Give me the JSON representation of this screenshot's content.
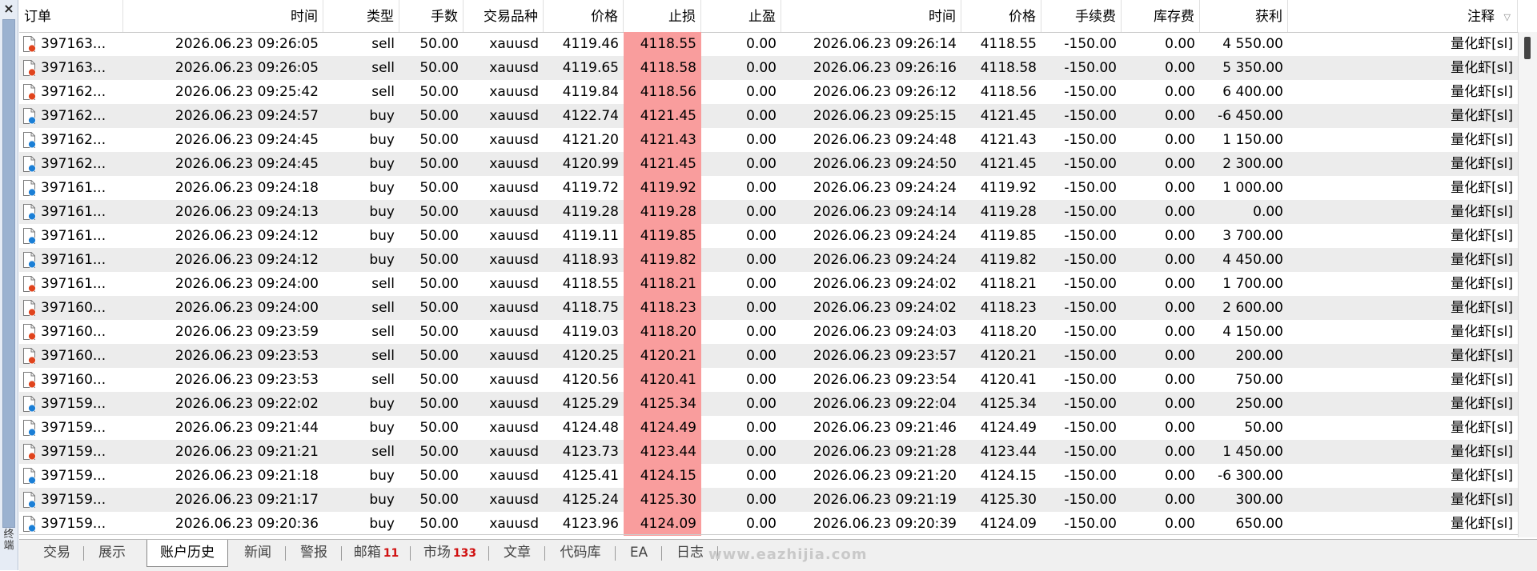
{
  "side_panel": {
    "close_glyph": "×",
    "label": "终端"
  },
  "columns": [
    "订单",
    "时间",
    "类型",
    "手数",
    "交易品种",
    "价格",
    "止损",
    "止盈",
    "时间",
    "价格",
    "手续费",
    "库存费",
    "获利",
    "注释"
  ],
  "colors": {
    "stop_loss_highlight": "#f99d9d",
    "row_alt": "#ececec",
    "sell_icon": "#e0441d",
    "buy_icon": "#1b7fd6",
    "badge": "#d01010"
  },
  "rows": [
    {
      "order": "397163...",
      "open_time": "2026.06.23 09:26:05",
      "type": "sell",
      "lots": "50.00",
      "symbol": "xauusd",
      "price": "4119.46",
      "sl": "4118.55",
      "tp": "0.00",
      "close_time": "2026.06.23 09:26:14",
      "close_price": "4118.55",
      "commission": "-150.00",
      "swap": "0.00",
      "profit": "4 550.00",
      "comment": "量化虾[sl]"
    },
    {
      "order": "397163...",
      "open_time": "2026.06.23 09:26:05",
      "type": "sell",
      "lots": "50.00",
      "symbol": "xauusd",
      "price": "4119.65",
      "sl": "4118.58",
      "tp": "0.00",
      "close_time": "2026.06.23 09:26:16",
      "close_price": "4118.58",
      "commission": "-150.00",
      "swap": "0.00",
      "profit": "5 350.00",
      "comment": "量化虾[sl]"
    },
    {
      "order": "397162...",
      "open_time": "2026.06.23 09:25:42",
      "type": "sell",
      "lots": "50.00",
      "symbol": "xauusd",
      "price": "4119.84",
      "sl": "4118.56",
      "tp": "0.00",
      "close_time": "2026.06.23 09:26:12",
      "close_price": "4118.56",
      "commission": "-150.00",
      "swap": "0.00",
      "profit": "6 400.00",
      "comment": "量化虾[sl]"
    },
    {
      "order": "397162...",
      "open_time": "2026.06.23 09:24:57",
      "type": "buy",
      "lots": "50.00",
      "symbol": "xauusd",
      "price": "4122.74",
      "sl": "4121.45",
      "tp": "0.00",
      "close_time": "2026.06.23 09:25:15",
      "close_price": "4121.45",
      "commission": "-150.00",
      "swap": "0.00",
      "profit": "-6 450.00",
      "comment": "量化虾[sl]"
    },
    {
      "order": "397162...",
      "open_time": "2026.06.23 09:24:45",
      "type": "buy",
      "lots": "50.00",
      "symbol": "xauusd",
      "price": "4121.20",
      "sl": "4121.43",
      "tp": "0.00",
      "close_time": "2026.06.23 09:24:48",
      "close_price": "4121.43",
      "commission": "-150.00",
      "swap": "0.00",
      "profit": "1 150.00",
      "comment": "量化虾[sl]"
    },
    {
      "order": "397162...",
      "open_time": "2026.06.23 09:24:45",
      "type": "buy",
      "lots": "50.00",
      "symbol": "xauusd",
      "price": "4120.99",
      "sl": "4121.45",
      "tp": "0.00",
      "close_time": "2026.06.23 09:24:50",
      "close_price": "4121.45",
      "commission": "-150.00",
      "swap": "0.00",
      "profit": "2 300.00",
      "comment": "量化虾[sl]"
    },
    {
      "order": "397161...",
      "open_time": "2026.06.23 09:24:18",
      "type": "buy",
      "lots": "50.00",
      "symbol": "xauusd",
      "price": "4119.72",
      "sl": "4119.92",
      "tp": "0.00",
      "close_time": "2026.06.23 09:24:24",
      "close_price": "4119.92",
      "commission": "-150.00",
      "swap": "0.00",
      "profit": "1 000.00",
      "comment": "量化虾[sl]"
    },
    {
      "order": "397161...",
      "open_time": "2026.06.23 09:24:13",
      "type": "buy",
      "lots": "50.00",
      "symbol": "xauusd",
      "price": "4119.28",
      "sl": "4119.28",
      "tp": "0.00",
      "close_time": "2026.06.23 09:24:14",
      "close_price": "4119.28",
      "commission": "-150.00",
      "swap": "0.00",
      "profit": "0.00",
      "comment": "量化虾[sl]"
    },
    {
      "order": "397161...",
      "open_time": "2026.06.23 09:24:12",
      "type": "buy",
      "lots": "50.00",
      "symbol": "xauusd",
      "price": "4119.11",
      "sl": "4119.85",
      "tp": "0.00",
      "close_time": "2026.06.23 09:24:24",
      "close_price": "4119.85",
      "commission": "-150.00",
      "swap": "0.00",
      "profit": "3 700.00",
      "comment": "量化虾[sl]"
    },
    {
      "order": "397161...",
      "open_time": "2026.06.23 09:24:12",
      "type": "buy",
      "lots": "50.00",
      "symbol": "xauusd",
      "price": "4118.93",
      "sl": "4119.82",
      "tp": "0.00",
      "close_time": "2026.06.23 09:24:24",
      "close_price": "4119.82",
      "commission": "-150.00",
      "swap": "0.00",
      "profit": "4 450.00",
      "comment": "量化虾[sl]"
    },
    {
      "order": "397161...",
      "open_time": "2026.06.23 09:24:00",
      "type": "sell",
      "lots": "50.00",
      "symbol": "xauusd",
      "price": "4118.55",
      "sl": "4118.21",
      "tp": "0.00",
      "close_time": "2026.06.23 09:24:02",
      "close_price": "4118.21",
      "commission": "-150.00",
      "swap": "0.00",
      "profit": "1 700.00",
      "comment": "量化虾[sl]"
    },
    {
      "order": "397160...",
      "open_time": "2026.06.23 09:24:00",
      "type": "sell",
      "lots": "50.00",
      "symbol": "xauusd",
      "price": "4118.75",
      "sl": "4118.23",
      "tp": "0.00",
      "close_time": "2026.06.23 09:24:02",
      "close_price": "4118.23",
      "commission": "-150.00",
      "swap": "0.00",
      "profit": "2 600.00",
      "comment": "量化虾[sl]"
    },
    {
      "order": "397160...",
      "open_time": "2026.06.23 09:23:59",
      "type": "sell",
      "lots": "50.00",
      "symbol": "xauusd",
      "price": "4119.03",
      "sl": "4118.20",
      "tp": "0.00",
      "close_time": "2026.06.23 09:24:03",
      "close_price": "4118.20",
      "commission": "-150.00",
      "swap": "0.00",
      "profit": "4 150.00",
      "comment": "量化虾[sl]"
    },
    {
      "order": "397160...",
      "open_time": "2026.06.23 09:23:53",
      "type": "sell",
      "lots": "50.00",
      "symbol": "xauusd",
      "price": "4120.25",
      "sl": "4120.21",
      "tp": "0.00",
      "close_time": "2026.06.23 09:23:57",
      "close_price": "4120.21",
      "commission": "-150.00",
      "swap": "0.00",
      "profit": "200.00",
      "comment": "量化虾[sl]"
    },
    {
      "order": "397160...",
      "open_time": "2026.06.23 09:23:53",
      "type": "sell",
      "lots": "50.00",
      "symbol": "xauusd",
      "price": "4120.56",
      "sl": "4120.41",
      "tp": "0.00",
      "close_time": "2026.06.23 09:23:54",
      "close_price": "4120.41",
      "commission": "-150.00",
      "swap": "0.00",
      "profit": "750.00",
      "comment": "量化虾[sl]"
    },
    {
      "order": "397159...",
      "open_time": "2026.06.23 09:22:02",
      "type": "buy",
      "lots": "50.00",
      "symbol": "xauusd",
      "price": "4125.29",
      "sl": "4125.34",
      "tp": "0.00",
      "close_time": "2026.06.23 09:22:04",
      "close_price": "4125.34",
      "commission": "-150.00",
      "swap": "0.00",
      "profit": "250.00",
      "comment": "量化虾[sl]"
    },
    {
      "order": "397159...",
      "open_time": "2026.06.23 09:21:44",
      "type": "buy",
      "lots": "50.00",
      "symbol": "xauusd",
      "price": "4124.48",
      "sl": "4124.49",
      "tp": "0.00",
      "close_time": "2026.06.23 09:21:46",
      "close_price": "4124.49",
      "commission": "-150.00",
      "swap": "0.00",
      "profit": "50.00",
      "comment": "量化虾[sl]"
    },
    {
      "order": "397159...",
      "open_time": "2026.06.23 09:21:21",
      "type": "sell",
      "lots": "50.00",
      "symbol": "xauusd",
      "price": "4123.73",
      "sl": "4123.44",
      "tp": "0.00",
      "close_time": "2026.06.23 09:21:28",
      "close_price": "4123.44",
      "commission": "-150.00",
      "swap": "0.00",
      "profit": "1 450.00",
      "comment": "量化虾[sl]"
    },
    {
      "order": "397159...",
      "open_time": "2026.06.23 09:21:18",
      "type": "buy",
      "lots": "50.00",
      "symbol": "xauusd",
      "price": "4125.41",
      "sl": "4124.15",
      "tp": "0.00",
      "close_time": "2026.06.23 09:21:20",
      "close_price": "4124.15",
      "commission": "-150.00",
      "swap": "0.00",
      "profit": "-6 300.00",
      "comment": "量化虾[sl]"
    },
    {
      "order": "397159...",
      "open_time": "2026.06.23 09:21:17",
      "type": "buy",
      "lots": "50.00",
      "symbol": "xauusd",
      "price": "4125.24",
      "sl": "4125.30",
      "tp": "0.00",
      "close_time": "2026.06.23 09:21:19",
      "close_price": "4125.30",
      "commission": "-150.00",
      "swap": "0.00",
      "profit": "300.00",
      "comment": "量化虾[sl]"
    },
    {
      "order": "397159...",
      "open_time": "2026.06.23 09:20:36",
      "type": "buy",
      "lots": "50.00",
      "symbol": "xauusd",
      "price": "4123.96",
      "sl": "4124.09",
      "tp": "0.00",
      "close_time": "2026.06.23 09:20:39",
      "close_price": "4124.09",
      "commission": "-150.00",
      "swap": "0.00",
      "profit": "650.00",
      "comment": "量化虾[sl]"
    }
  ],
  "tabs": [
    {
      "label": "交易",
      "badge": "",
      "active": false
    },
    {
      "label": "展示",
      "badge": "",
      "active": false
    },
    {
      "label": "账户历史",
      "badge": "",
      "active": true
    },
    {
      "label": "新闻",
      "badge": "",
      "active": false
    },
    {
      "label": "警报",
      "badge": "",
      "active": false
    },
    {
      "label": "邮箱",
      "badge": "11",
      "active": false
    },
    {
      "label": "市场",
      "badge": "133",
      "active": false
    },
    {
      "label": "文章",
      "badge": "",
      "active": false
    },
    {
      "label": "代码库",
      "badge": "",
      "active": false
    },
    {
      "label": "EA",
      "badge": "",
      "active": false
    },
    {
      "label": "日志",
      "badge": "",
      "active": false
    }
  ],
  "watermark": "www.eazhijia.com"
}
